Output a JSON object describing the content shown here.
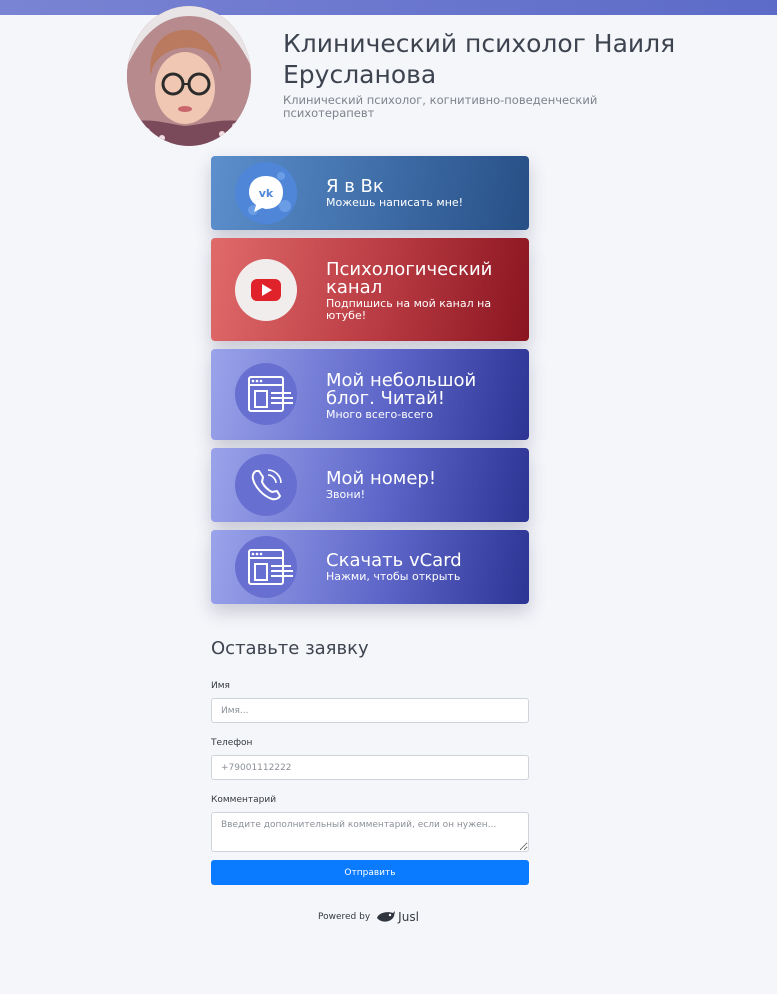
{
  "header": {
    "title": "Клинический психолог Наиля Ерусланова",
    "subtitle": "Клинический психолог, когнитивно-поведенческий психотерапевт"
  },
  "links": [
    {
      "title": "Я в Вк",
      "subtitle": "Можешь написать мне!",
      "icon": "vk-icon"
    },
    {
      "title": "Психологический канал",
      "subtitle": "Подпишись на мой канал на ютубе!",
      "icon": "youtube-icon"
    },
    {
      "title": "Мой небольшой блог. Читай!",
      "subtitle": "Много всего-всего",
      "icon": "browser-icon"
    },
    {
      "title": "Мой номер!",
      "subtitle": "Звони!",
      "icon": "phone-icon"
    },
    {
      "title": "Скачать vCard",
      "subtitle": "Нажми, чтобы открыть",
      "icon": "browser-icon"
    }
  ],
  "form": {
    "title": "Оставьте заявку",
    "name_label": "Имя",
    "name_placeholder": "Имя...",
    "phone_label": "Телефон",
    "phone_placeholder": "+79001112222",
    "comment_label": "Комментарий",
    "comment_placeholder": "Введите дополнительный комментарий, если он нужен...",
    "submit_label": "Отправить"
  },
  "footer": {
    "powered_by": "Powered by",
    "brand": "Jusl"
  },
  "colors": {
    "accent": "#0a7bff",
    "vk": "#3e6ca6",
    "youtube": "#b83a42",
    "indigo": "#5d66c8"
  }
}
